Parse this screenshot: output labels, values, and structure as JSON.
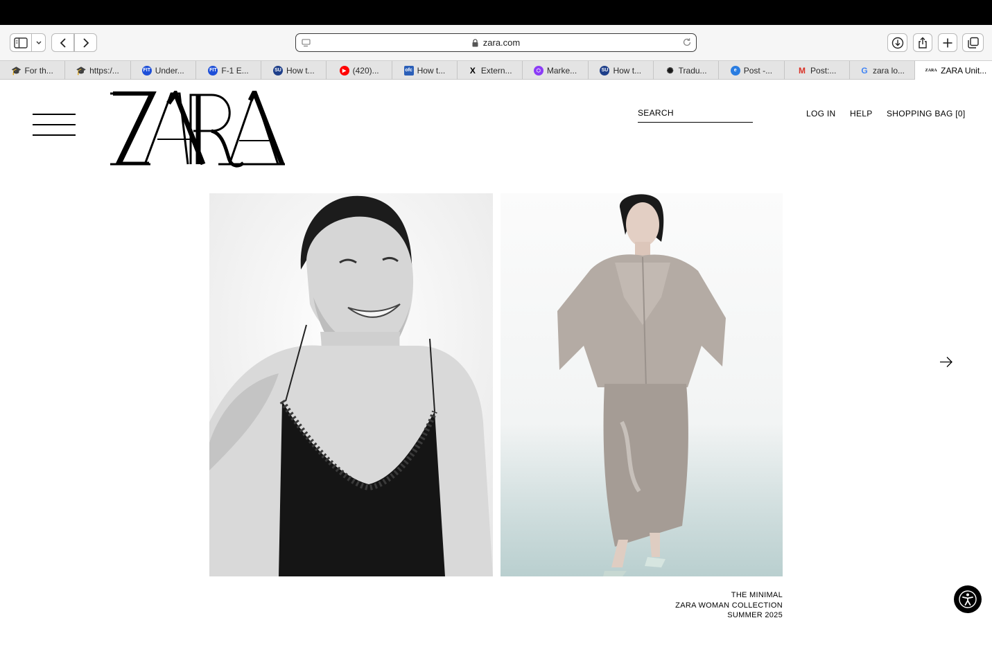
{
  "browser": {
    "url": "zara.com",
    "tabs": [
      {
        "label": "For th...",
        "icon": "graduation-cap-icon",
        "color": "#7a3b14"
      },
      {
        "label": "https:/...",
        "icon": "graduation-cap-icon",
        "color": "#7a3b14"
      },
      {
        "label": "Under...",
        "icon": "fit-icon",
        "color": "#1d4fd8",
        "badge": "FIT"
      },
      {
        "label": "F-1 E...",
        "icon": "fit-icon",
        "color": "#1d4fd8",
        "badge": "FIT"
      },
      {
        "label": "How t...",
        "icon": "suny-icon",
        "color": "#1e3f8a",
        "badge": "SU"
      },
      {
        "label": "(420)...",
        "icon": "youtube-icon",
        "color": "#ff0000",
        "badge": "▶"
      },
      {
        "label": "How t...",
        "icon": "office-icon",
        "color": "#2b5fb8",
        "badge": "ofc"
      },
      {
        "label": "Extern...",
        "icon": "x-icon",
        "color": "#000000",
        "badge": "X"
      },
      {
        "label": "Marke...",
        "icon": "hexagon-icon",
        "color": "#8b3cf6",
        "badge": "⬡"
      },
      {
        "label": "How t...",
        "icon": "suny-icon",
        "color": "#1e3f8a",
        "badge": "SU"
      },
      {
        "label": "Tradu...",
        "icon": "openai-icon",
        "color": "#1a1a1a",
        "badge": "✺"
      },
      {
        "label": "Post -...",
        "icon": "edge-icon",
        "color": "#2a7de1",
        "badge": "e"
      },
      {
        "label": "Post:...",
        "icon": "gmail-icon",
        "color": "#d93025",
        "badge": "M"
      },
      {
        "label": "zara lo...",
        "icon": "google-icon",
        "color": "#4285f4",
        "badge": "G"
      },
      {
        "label": "ZARA Unit...",
        "icon": "zara-icon",
        "color": "#000000",
        "badge": "ZARA",
        "active": true
      }
    ]
  },
  "header": {
    "search_label": "SEARCH",
    "login_label": "LOG IN",
    "help_label": "HELP",
    "bag_label": "SHOPPING BAG [0]"
  },
  "caption": {
    "line1": "THE MINIMAL",
    "line2": "ZARA WOMAN COLLECTION",
    "line3": "SUMMER 2025"
  }
}
